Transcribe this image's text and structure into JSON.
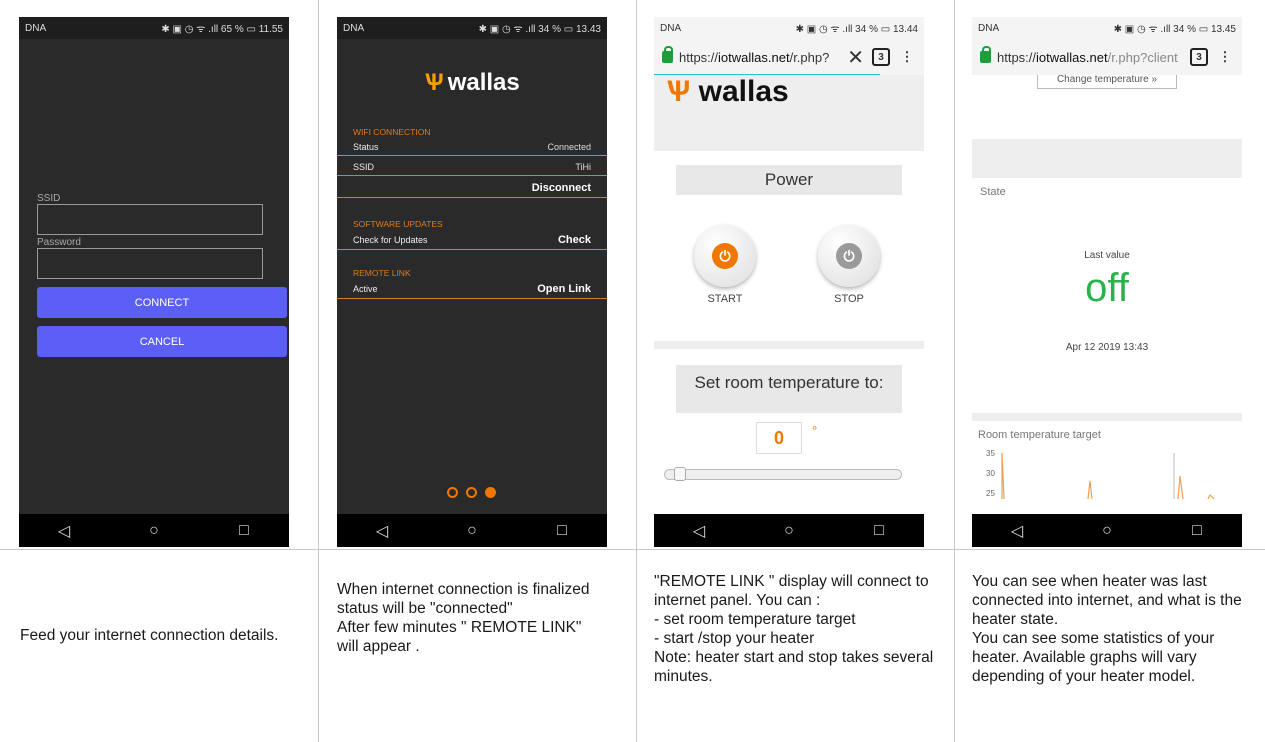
{
  "phones": {
    "p1": {
      "status_left": "DNA",
      "status_right": "✱ ▣ ◷ ᯤ .ıll 65 % ▭ 11.55",
      "ssid_label": "SSID",
      "password_label": "Password",
      "connect": "CONNECT",
      "cancel": "CANCEL"
    },
    "p2": {
      "status_left": "DNA",
      "status_right": "✱ ▣ ◷ ᯤ .ıll 34 % ▭ 13.43",
      "logo": "wallas",
      "wifi_head": "WIFI CONNECTION",
      "status_label": "Status",
      "status_value": "Connected",
      "ssid_label": "SSID",
      "ssid_value": "TiHi",
      "disconnect": "Disconnect",
      "sw_head": "SOFTWARE UPDATES",
      "check_label": "Check for Updates",
      "check": "Check",
      "remote_head": "REMOTE LINK",
      "active_label": "Active",
      "open_link": "Open Link"
    },
    "p3": {
      "status_left": "DNA",
      "status_right": "✱ ▣ ◷ ᯤ .ıll 34 % ▭ 13.44",
      "url_prefix": "https://",
      "url_host": "iotwallas.net",
      "url_rest": "/r.php?",
      "tabs": "3",
      "logo": "wallas",
      "power_title": "Power",
      "start": "START",
      "stop": "STOP",
      "set_title": "Set room temperature to:",
      "temp": "0",
      "deg": "°"
    },
    "p4": {
      "status_left": "DNA",
      "status_right": "✱ ▣ ◷ ᯤ .ıll 34 % ▭ 13.45",
      "url_prefix": "https://",
      "url_host": "iotwallas.net",
      "url_rest": "/r.php?client",
      "tabs": "3",
      "change_btn": "Change temperature »",
      "state_label": "State",
      "last_value": "Last value",
      "state_value": "off",
      "timestamp": "Apr 12 2019 13:43",
      "chart_title": "Room temperature target",
      "y_ticks": [
        "35",
        "30",
        "25"
      ]
    }
  },
  "nav": {
    "back": "◁",
    "home": "○",
    "recent": "□"
  },
  "captions": {
    "c1": "Feed your internet connection details.",
    "c2": "When internet connection is finalized status will be \"connected\"\nAfter few minutes \" REMOTE LINK\"\nwill appear .",
    "c3": "\"REMOTE LINK \" display will connect to internet panel. You can :\n- set room temperature target\n- start /stop your heater\nNote: heater start and stop takes several minutes.",
    "c4": "You can see when heater was last connected into internet, and what is the heater state.\nYou can see some statistics of your heater.  Available graphs will vary depending of your heater model."
  }
}
